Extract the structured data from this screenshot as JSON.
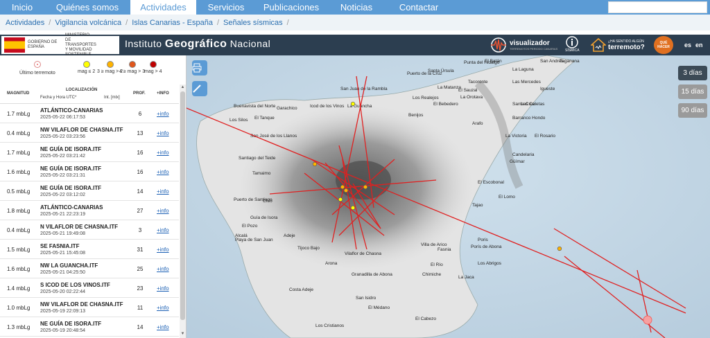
{
  "nav": {
    "items": [
      {
        "label": "Inicio"
      },
      {
        "label": "Quiénes somos"
      },
      {
        "label": "Actividades"
      },
      {
        "label": "Servicios"
      },
      {
        "label": "Publicaciones"
      },
      {
        "label": "Noticias"
      },
      {
        "label": "Contactar"
      }
    ],
    "active_index": 2
  },
  "breadcrumb": [
    "Actividades",
    "Vigilancia volcánica",
    "Islas Canarias - España",
    "Señales sísmicas"
  ],
  "header": {
    "gov_text": "GOBIERNO DE ESPAÑA",
    "ministry_text": "MINISTERIO DE TRANSPORTES Y MOVILIDAD SOSTENIBLE",
    "ign_prefix": "Instituto",
    "ign_main": "Geográfico",
    "ign_suffix": "Nacional",
    "visualizador": "visualizador",
    "visualizador_sub": "TERREMOTOS PERIODO CANARIAS",
    "sismica": "SÍSMICA",
    "terremoto_q": "¿HA SENTIDO ALGÚN",
    "terremoto": "terremoto?",
    "que_hacer": "QUÉ HACER",
    "lang_es": "es",
    "lang_en": "en"
  },
  "legend": {
    "last": "Último terremoto",
    "items": [
      {
        "label": "mag ≤ 2",
        "color": "#ffff00"
      },
      {
        "label": "3 ≥ mag > 2",
        "color": "#ffb300"
      },
      {
        "label": "4 ≥ mag > 3",
        "color": "#e0561b"
      },
      {
        "label": "mag > 4",
        "color": "#c00000"
      }
    ]
  },
  "table": {
    "headers": {
      "mag": "MAGNITUD",
      "loc": "LOCALIZACIÓN",
      "date": "Fecha y Hora UTC*",
      "int": "Int. [mlx]",
      "prof": "PROF.",
      "info": "+INFO"
    },
    "rows": [
      {
        "mag": "1.7 mbLg",
        "loc": "ATLÁNTICO-CANARIAS",
        "dt": "2025-05-22 06:17:53",
        "prof": "6",
        "info": "+info"
      },
      {
        "mag": "0.4 mbLg",
        "loc": "NW VILAFLOR DE CHASNA.ITF",
        "dt": "2025-05-22 03:23:56",
        "prof": "13",
        "info": "+info"
      },
      {
        "mag": "1.7 mbLg",
        "loc": "NE GUÍA DE ISORA.ITF",
        "dt": "2025-05-22 03:21:42",
        "prof": "16",
        "info": "+info"
      },
      {
        "mag": "1.6 mbLg",
        "loc": "NE GUÍA DE ISORA.ITF",
        "dt": "2025-05-22 03:21:31",
        "prof": "16",
        "info": "+info"
      },
      {
        "mag": "0.5 mbLg",
        "loc": "NE GUÍA DE ISORA.ITF",
        "dt": "2025-05-22 03:12:02",
        "prof": "14",
        "info": "+info"
      },
      {
        "mag": "1.8 mbLg",
        "loc": "ATLÁNTICO-CANARIAS",
        "dt": "2025-05-21 22:23:19",
        "prof": "27",
        "info": "+info"
      },
      {
        "mag": "0.4 mbLg",
        "loc": "N VILAFLOR DE CHASNA.ITF",
        "dt": "2025-05-21 19:49:08",
        "prof": "3",
        "info": "+info"
      },
      {
        "mag": "1.5 mbLg",
        "loc": "SE FASNIA.ITF",
        "dt": "2025-05-21 15:45:08",
        "prof": "31",
        "info": "+info"
      },
      {
        "mag": "1.6 mbLg",
        "loc": "NW LA GUANCHA.ITF",
        "dt": "2025-05-21 04:25:50",
        "prof": "25",
        "info": "+info"
      },
      {
        "mag": "1.4 mbLg",
        "loc": "S ICOD DE LOS VINOS.ITF",
        "dt": "2025-05-20 02:22:44",
        "prof": "23",
        "info": "+info"
      },
      {
        "mag": "1.0 mbLg",
        "loc": "NW VILAFLOR DE CHASNA.ITF",
        "dt": "2025-05-19 22:09:13",
        "prof": "11",
        "info": "+info"
      },
      {
        "mag": "1.3 mbLg",
        "loc": "NE GUÍA DE ISORA.ITF",
        "dt": "2025-05-19 20:48:54",
        "prof": "14",
        "info": "+info"
      }
    ]
  },
  "map": {
    "day_buttons": [
      "3 días",
      "15 días",
      "90 días"
    ],
    "active_day": 0,
    "places": [
      "Punta del Hidalgo",
      "El Batán",
      "Santa Úrsula",
      "San Juan de la Rambla",
      "Puerto de la Cruz",
      "La Orotava",
      "Icod de los Vinos",
      "La Guancha",
      "Buenavista del Norte",
      "El Tanque",
      "Garachico",
      "Los Silos",
      "San José de los Llanos",
      "Santiago del Teide",
      "Tamaimo",
      "Puerto de Santiago",
      "Chío",
      "Guía de Isora",
      "El Pozo",
      "Alcalá",
      "Playa de San Juan",
      "Adeje",
      "Tijoco Bajo",
      "Arona",
      "Los Cristianos",
      "Vilaflor de Chasna",
      "Granadilla de Abona",
      "San Isidro",
      "El Médano",
      "Fasnia",
      "Arafo",
      "Candelaria",
      "El Escobonal",
      "Güímar",
      "Los Abrigos",
      "Porís de Abona",
      "El Río",
      "Chimiche",
      "Villa de Arico",
      "El Cabezo",
      "Costa Adeje",
      "San Andrés",
      "La Laguna",
      "Tacoronte",
      "El Sauzal",
      "Los Realejos",
      "La Matanza",
      "Santa Cruz",
      "Igueste",
      "Taganana",
      "Benijos",
      "Las Mercedes",
      "La Victoria",
      "El Rosario",
      "Las Caletas",
      "Barranco Hondo",
      "La Jaca",
      "Poris",
      "El Bebedero",
      "Tajao",
      "El Lomo"
    ],
    "epicenters": [
      {
        "mag": 1.7,
        "color": "#ffb300"
      },
      {
        "mag": 0.4,
        "color": "#ffff00"
      },
      {
        "mag": 1.7,
        "color": "#ffb300"
      },
      {
        "mag": 1.6,
        "color": "#ffb300"
      },
      {
        "mag": 0.5,
        "color": "#ffff00"
      },
      {
        "mag": 1.8,
        "color": "#ffb300"
      },
      {
        "mag": 0.4,
        "color": "#ffff00"
      },
      {
        "mag": 1.5,
        "color": "#ffb300"
      }
    ]
  }
}
